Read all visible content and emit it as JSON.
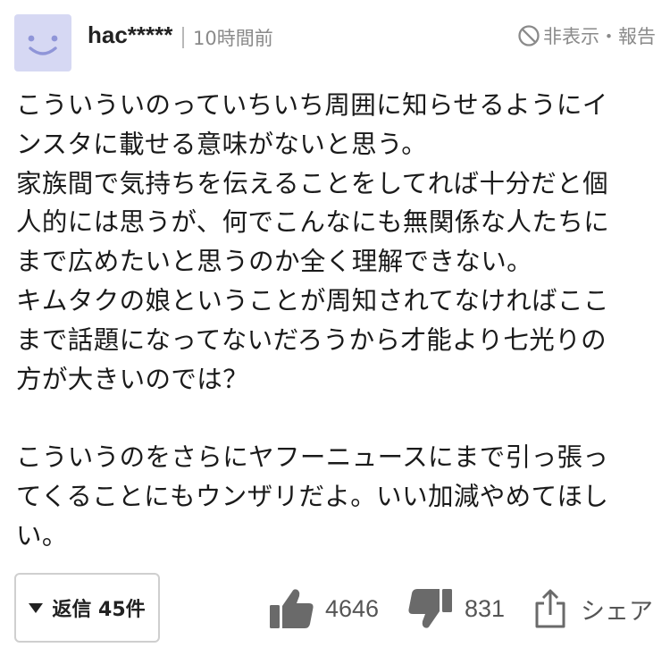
{
  "comment": {
    "username": "hac*****",
    "time": "10時間前",
    "hide_report": "非表示・報告",
    "lines": [
      "こういういのっていちいち周囲に知らせるようにイ",
      "ンスタに載せる意味がないと思う。",
      "家族間で気持ちを伝えることをしてれば十分だと個",
      "人的には思うが、何でこんなにも無関係な人たちに",
      "まで広めたいと思うのか全く理解できない。",
      "キムタクの娘ということが周知されてなければここ",
      "まで話題になってないだろうから才能より七光りの",
      "方が大きいのでは？",
      "",
      "こういうのをさらにヤフーニュースにまで引っ張っ",
      "てくることにもウンザリだよ。いい加減やめてほし",
      "い。"
    ]
  },
  "footer": {
    "reply_label": "返信 45件",
    "like_count": "4646",
    "dislike_count": "831",
    "share_label": "シェア"
  },
  "colors": {
    "avatar_bg": "#d6d8f3",
    "avatar_face": "#8f95d8",
    "muted": "#8a8a8a"
  }
}
